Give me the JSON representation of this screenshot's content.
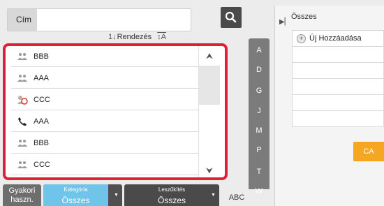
{
  "search": {
    "label": "Cím",
    "value": ""
  },
  "sort": {
    "label": "Rendezés"
  },
  "contacts": [
    {
      "name": "BBB",
      "icon": "group-icon"
    },
    {
      "name": "AAA",
      "icon": "group-icon"
    },
    {
      "name": "CCC",
      "icon": "multi-address-icon"
    },
    {
      "name": "AAA",
      "icon": "phone-icon"
    },
    {
      "name": "BBB",
      "icon": "group-icon"
    },
    {
      "name": "CCC",
      "icon": "group-icon"
    }
  ],
  "alpha_index": [
    "A",
    "D",
    "G",
    "J",
    "M",
    "P",
    "T",
    "W"
  ],
  "right_panel": {
    "title": "Összes",
    "add_new": "Új Hozzáadása",
    "ca_button": "CA"
  },
  "bottom": {
    "gyakori_line1": "Gyakori",
    "gyakori_line2": "haszn.",
    "kategoria_label": "Kategória",
    "kategoria_value": "Összes",
    "leszukites_label": "Leszűkítés",
    "leszukites_value": "Összes",
    "abc": "ABC"
  },
  "colors": {
    "highlight_border": "#e0203a",
    "ca_button": "#f5a623",
    "kategoria_active": "#6fc4ea"
  }
}
